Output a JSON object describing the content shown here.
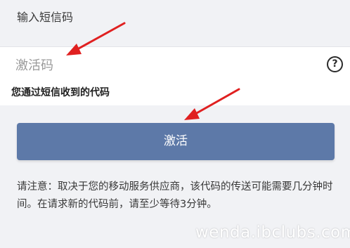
{
  "header": {
    "title": "输入短信码"
  },
  "code_field": {
    "placeholder": "激活码",
    "value": "",
    "help_icon": "question-mark-icon"
  },
  "hint": {
    "text": "您通过短信收到的代码"
  },
  "actions": {
    "activate_label": "激活"
  },
  "notice": {
    "text": "请注意：取决于您的移动服务供应商，该代码的传送可能需要几分钟时间。在请求新的代码前，请至少等待3分钟。"
  },
  "watermark": {
    "text": "wenda.ibclubs.com"
  },
  "annotations": {
    "arrow_color": "#e02020"
  },
  "theme": {
    "background": "#f1f2f5",
    "button_color": "#5d79a8"
  }
}
